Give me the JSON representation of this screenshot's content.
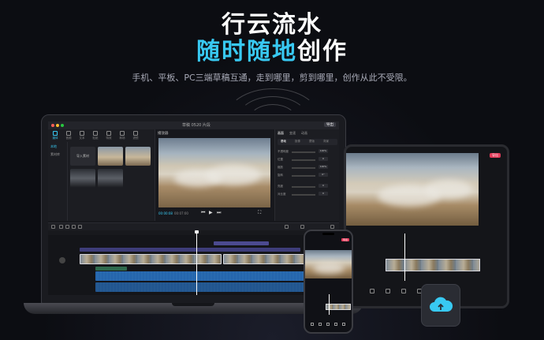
{
  "hero": {
    "title_line1": "行云流水",
    "title_line2_highlight": "随时随地",
    "title_line2_rest": "创作",
    "subtitle": "手机、平板、PC三端草稿互通，走到哪里，剪到哪里，创作从此不受限。"
  },
  "desktop_app": {
    "project_name": "草稿 0520 片段",
    "export_label": "导出",
    "media_tabs": [
      "媒体",
      "音频",
      "文本",
      "贴纸",
      "特效",
      "转场",
      "滤镜"
    ],
    "media_side_items": [
      "本地",
      "素材库"
    ],
    "import_label": "导入素材",
    "player_label": "播放器",
    "timecode_current": "00:00:08",
    "timecode_total": "00:07:00",
    "props_tabs": [
      "画面",
      "变速",
      "动画"
    ],
    "props_subtabs": [
      "基础",
      "抠像",
      "蒙版",
      "背景"
    ],
    "props_rows": [
      {
        "label": "不透明度",
        "value": "100%"
      },
      {
        "label": "位置",
        "value": "0"
      },
      {
        "label": "缩放",
        "value": "100%"
      },
      {
        "label": "旋转",
        "value": "0°"
      },
      {
        "label": "亮度",
        "value": "0"
      },
      {
        "label": "对比度",
        "value": "0"
      }
    ]
  },
  "tablet_app": {
    "export_label": "导出"
  },
  "phone_app": {
    "export_label": "导出"
  },
  "colors": {
    "accent": "#38c9f2",
    "export_red": "#e23b5a",
    "background": "#0c0d12"
  },
  "icons": [
    "cloud-icon",
    "play-icon",
    "undo-icon",
    "split-icon"
  ]
}
